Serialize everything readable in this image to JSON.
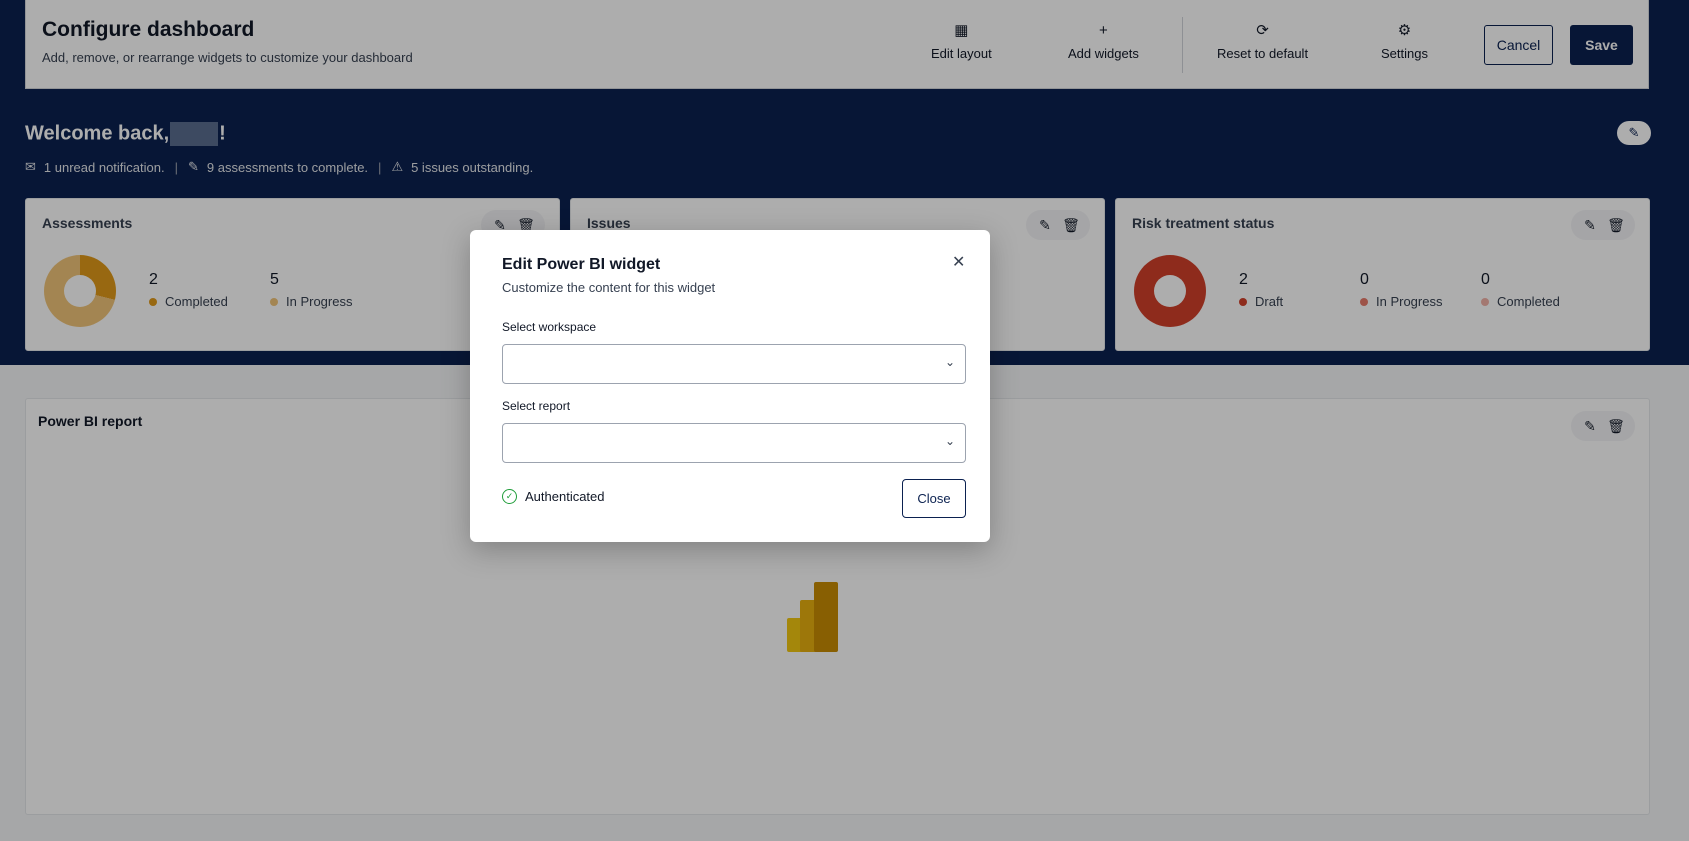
{
  "config": {
    "title": "Configure dashboard",
    "subtitle": "Add, remove, or rearrange widgets to customize your dashboard",
    "tools": [
      {
        "label": "Edit layout",
        "icon": "grid-layout-icon"
      },
      {
        "label": "Add widgets",
        "icon": "plus-icon"
      },
      {
        "label": "Reset to default",
        "icon": "refresh-icon"
      },
      {
        "label": "Settings",
        "icon": "gear-icon"
      }
    ],
    "cancel_label": "Cancel",
    "save_label": "Save"
  },
  "hero": {
    "welcome_prefix": "Welcome back,",
    "welcome_suffix": "!",
    "notifications": "1 unread notification.",
    "assessments": "9 assessments to complete.",
    "issues": "5 issues outstanding."
  },
  "cards": {
    "assessments": {
      "title": "Assessments",
      "stats": [
        {
          "value": "2",
          "label": "Completed",
          "color": "#e09a1a"
        },
        {
          "value": "5",
          "label": "In Progress",
          "color": "#f1c57a"
        }
      ]
    },
    "issues": {
      "title": "Issues"
    },
    "risk": {
      "title": "Risk treatment status",
      "stats": [
        {
          "value": "2",
          "label": "Draft",
          "color": "#d2402a"
        },
        {
          "value": "0",
          "label": "In Progress",
          "color": "#e77b6b"
        },
        {
          "value": "0",
          "label": "Completed",
          "color": "#f0b2a7"
        }
      ]
    },
    "powerbi": {
      "title": "Power BI report"
    }
  },
  "modal": {
    "title": "Edit Power BI widget",
    "subtitle": "Customize the content for this widget",
    "workspace_label": "Select workspace",
    "workspace_value": "",
    "report_label": "Select report",
    "report_value": "",
    "auth_status": "Authenticated",
    "close_label": "Close"
  },
  "colors": {
    "navy": "#0b2150",
    "accent_orange": "#e09a1a",
    "risk_red": "#d2402a",
    "success_green": "#1f9d3a"
  }
}
